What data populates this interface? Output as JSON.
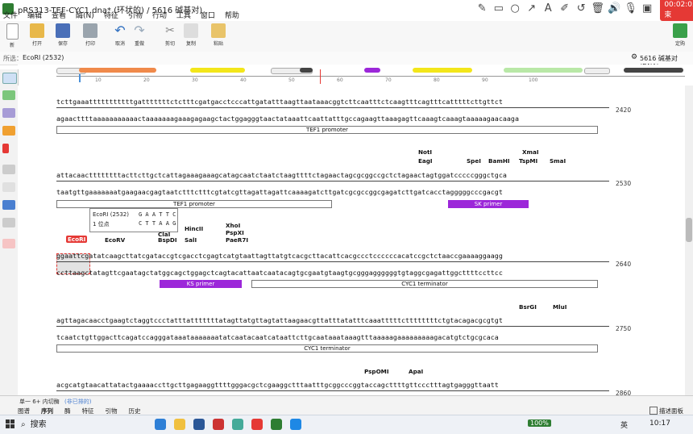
{
  "window": {
    "title": "pRS313-TEF-CYC1.dna* (环状的) / 5616 碱基对)"
  },
  "recorder": {
    "timer": "00:02:05 结束"
  },
  "menu": [
    "文件",
    "编辑",
    "查看",
    "酶(N)",
    "特征",
    "引物",
    "行动",
    "工具",
    "窗口",
    "帮助"
  ],
  "toolbar": {
    "new": "新",
    "open": "打开",
    "save": "保存",
    "print": "打印",
    "undo": "取消",
    "redo": "重做",
    "cut": "剪切",
    "copy": "复制",
    "paste": "粘贴",
    "cart": "定购"
  },
  "selection": {
    "label": "所选：",
    "enzyme": "EcoRI (2532)",
    "total": "5616 碱基对 (DNA)"
  },
  "map_ticks": [
    "10",
    "20",
    "30",
    "40",
    "50",
    "60",
    "70",
    "80",
    "90",
    "100"
  ],
  "colors": {
    "orange": "#f08a4b",
    "yellow": "#f3e61a",
    "green": "#b9e8a7",
    "purple": "#9c27d9",
    "red": "#e53935",
    "dark": "#444"
  },
  "rows": [
    {
      "top": "tcttgaaatttttttttttgatttttttctctttcgatgacctcccattgatatttaagttaataaacggtcttcaatttctcaagtttcagtttcatttttcttgttct",
      "bottom": "agaacttttaaaaaaaaaaactaaaaaaagaaagagaagctactggagggtaactataaattcaattatttgccagaagttaaagagttcaaagtcaaagtaaaaagaacaaga",
      "pos": "2420",
      "features": [
        "TEF1 promoter"
      ]
    },
    {
      "top": "attacaacttttttttacttcttgctcattagaaagaaagcatagcaatctaatctaagttttctagaactagcgcggccgctctagaactagtggatcccccgggctgca",
      "bottom": "taatgttgaaaaaaatgaagaacgagtaatctttctttcgtatcgttagattagattcaaaagatcttgatcgcgccggcgagatcttgatcacctagggggcccgacgt",
      "pos": "2530",
      "features": [
        "TEF1 promoter",
        "SK primer"
      ],
      "enzymes": [
        "NotI",
        "EagI",
        "SpeI",
        "BamHI",
        "XmaI",
        "TspMI",
        "SmaI"
      ]
    },
    {
      "top": "ggaattcgatatcaagcttatcgataccgtcgacctcgagtcatgtaattagttatgtcacgcttacattcacgccctccccccacatccgctctaaccgaaaaggaagg",
      "bottom": "ccttaagctatagttcgaatagctatggcagctggagctcagtacattaatcaatacagtgcgaatgtaagtgcgggaggggggtgtaggcgagattggcttttccttcc",
      "pos": "2640",
      "features": [
        "KS primer",
        "CYC1 terminator"
      ],
      "enzymes": [
        "EcoRI",
        "EcoRV",
        "ClaI",
        "BspDI",
        "HincII",
        "SalI",
        "XhoI",
        "PspXI",
        "PaeR7I"
      ]
    },
    {
      "top": "agttagacaacctgaagtctaggtccctatttatttttttatagttatgttagtattaagaacgttatttatatttcaaatttttcttttttttctgtacagacgcgtgt",
      "bottom": "tcaatctgttggacttcagatccagggataaataaaaaaatatcaatacaatcataattcttgcaataaataaagtttaaaaagaaaaaaaaagacatgtctgcgcaca",
      "pos": "2750",
      "features": [
        "CYC1 terminator"
      ],
      "enzymes": [
        "BsrGI",
        "MluI"
      ]
    },
    {
      "top": "acgcatgtaacattatactgaaaaccttgcttgagaaggttttgggacgctcgaaggctttaatttgcggcccggtaccagcttttgttccctttagtgagggttaatt",
      "bottom": "tgcgtacattgtaatatgacttttggaacgaactccttccaaaaccctgcgagcttccgaaattaaacgccgggccatggtcgaaaacaagggaaatcactcccaattaa",
      "pos": "2860",
      "features": [],
      "enzymes": [
        "PspOMI",
        "ApaI"
      ]
    }
  ],
  "tooltip": {
    "name": "EcoRI (2532)",
    "site": "1 位点",
    "top": "G A A T T C",
    "bottom": "C T T A A G"
  },
  "bottom": {
    "info": "单一 6+ 内切酶",
    "info2": "(非已排的)",
    "tabs": [
      "图谱",
      "序列",
      "酶",
      "特征",
      "引物",
      "历史"
    ],
    "panel": "描述面板"
  },
  "taskbar": {
    "search": "搜索",
    "battery": "100%",
    "lang": "英",
    "time": "10:17"
  }
}
